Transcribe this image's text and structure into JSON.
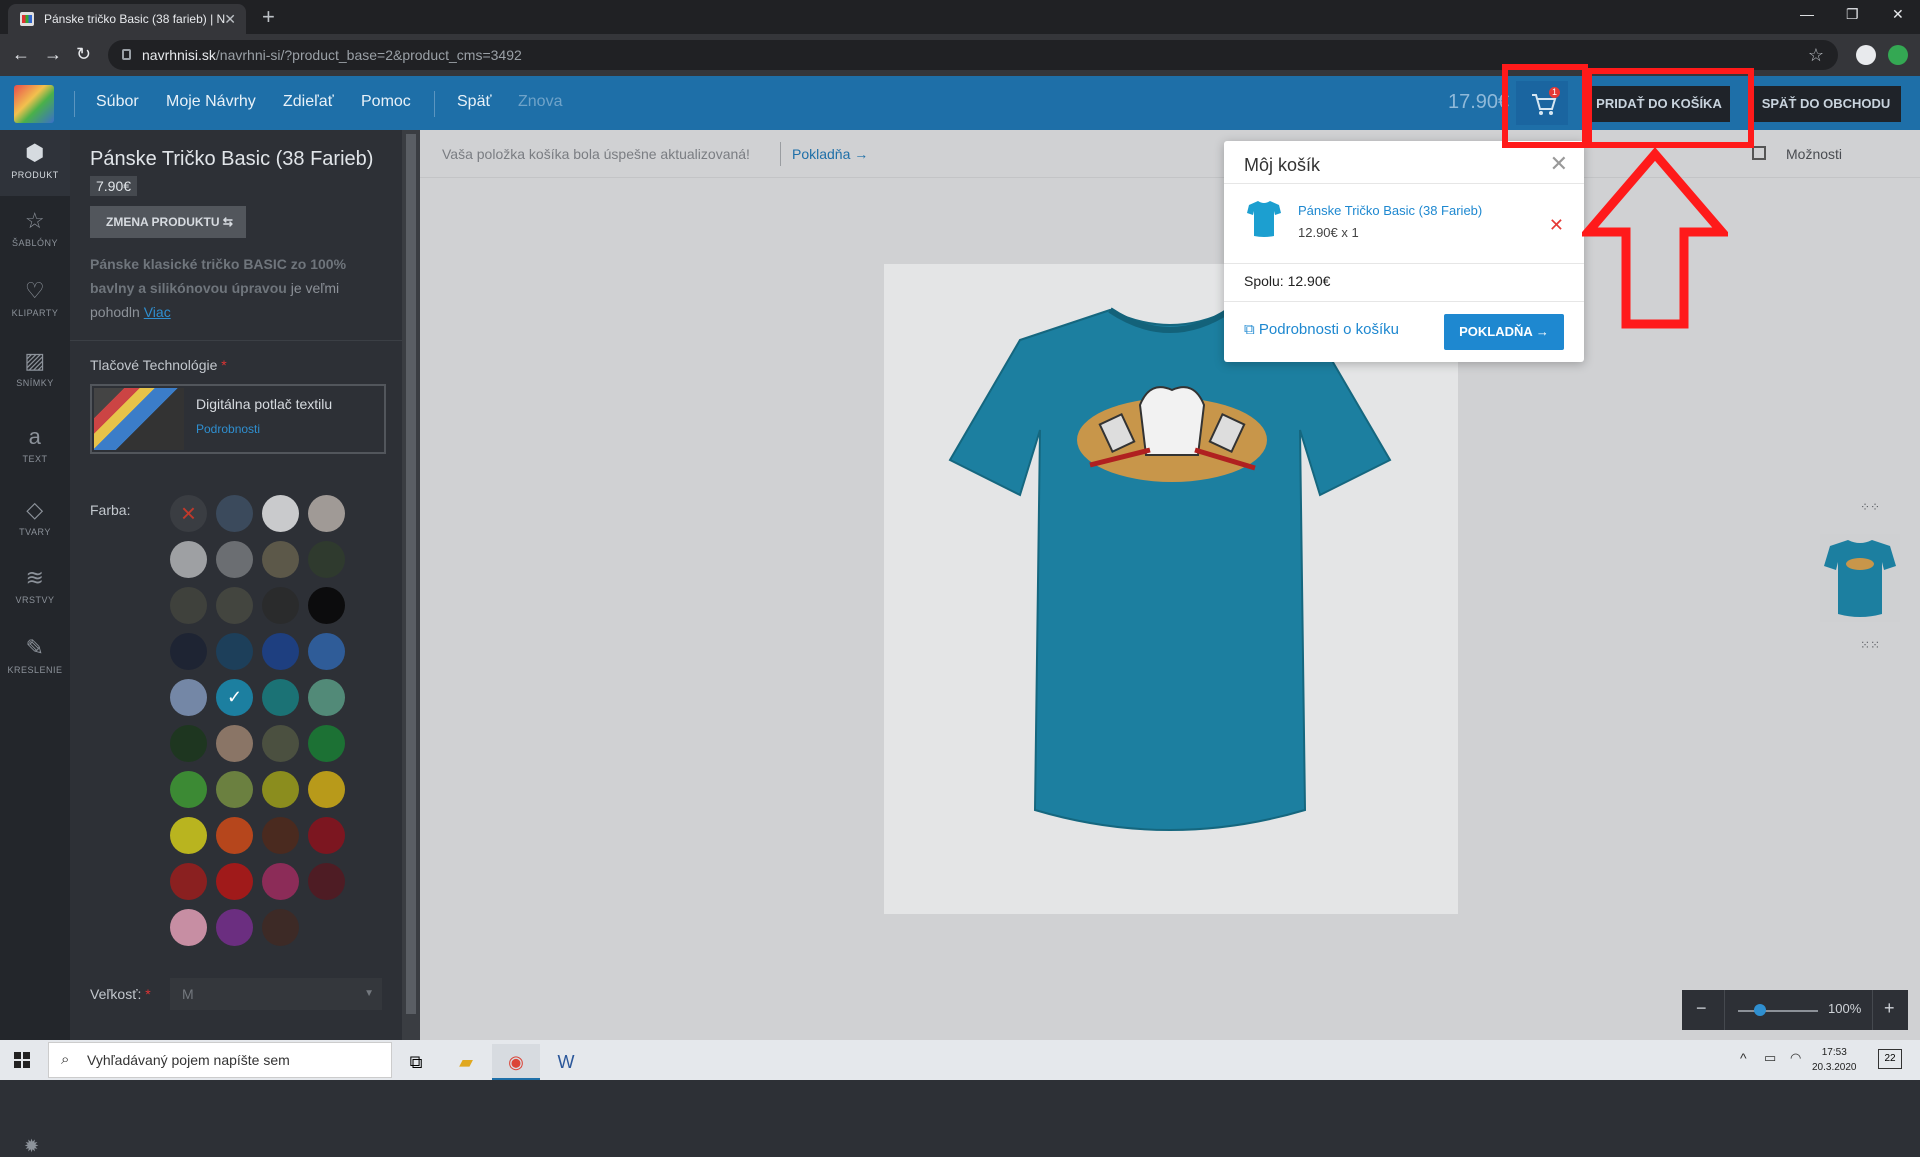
{
  "browser": {
    "tab_title": "Pánske tričko Basic (38 farieb) | N",
    "url_domain": "navrhnisi.sk",
    "url_path": "/navrhni-si/?product_base=2&product_cms=3492"
  },
  "header": {
    "menu": [
      "Súbor",
      "Moje Návrhy",
      "Zdieľať",
      "Pomoc",
      "Späť",
      "Znova"
    ],
    "price": "17.90€",
    "cart_count": "1",
    "add_to_cart_label": "PRIDAŤ DO KOŠÍKA",
    "back_to_shop_label": "SPÄŤ DO OBCHODU"
  },
  "rail": [
    "PRODUKT",
    "ŠABLÓNY",
    "KLIPARTY",
    "SNÍMKY",
    "TEXT",
    "TVARY",
    "VRSTVY",
    "KRESLENIE"
  ],
  "product": {
    "title": "Pánske Tričko Basic (38 Farieb)",
    "price": "7.90€",
    "change_label": "ZMENA PRODUKTU ⇆",
    "desc_bold": "Pánske klasické tričko BASIC zo 100% bavlny a silikónovou úpravou",
    "desc_rest": " je veľmi pohodln ",
    "more_link": "Viac",
    "tech_label": "Tlačové Technológie",
    "tech_name": "Digitálna potlač textilu",
    "tech_link": "Podrobnosti",
    "color_label": "Farba:",
    "size_label": "Veľkosť:",
    "size_value": "M"
  },
  "colors": [
    "#3a3d42",
    "#3b4a5c",
    "#c9cacc",
    "#a09a96",
    "#9ea0a3",
    "#6b6e72",
    "#5c5849",
    "#2f3a2e",
    "#3f413c",
    "#43453f",
    "#2a2b2c",
    "#0c0c0d",
    "#1e2433",
    "#1d3f5a",
    "#1e3f80",
    "#2f5c98",
    "#7487a6",
    "#1c7fa0",
    "#1b7275",
    "#528a78",
    "#1e3620",
    "#8a7566",
    "#4b5040",
    "#1c7134",
    "#3c8a34",
    "#6b8040",
    "#8b8d1e",
    "#b89a1a",
    "#b9b41f",
    "#b6461c",
    "#4a2a1f",
    "#7c1620",
    "#8a2020",
    "#a01a1a",
    "#8c2c58",
    "#4e1c24",
    "#c78ea3",
    "#6b2e80",
    "#3d2a26"
  ],
  "canvas": {
    "notice": "Vaša položka košíka bola úspešne aktualizovaná!",
    "checkout_link": "Pokladňa",
    "options_label": "Možnosti",
    "zoom": "100%"
  },
  "cart_popup": {
    "title": "Môj košík",
    "item_name": "Pánske Tričko Basic (38 Farieb)",
    "item_qty": "12.90€ x 1",
    "total": "Spolu: 12.90€",
    "details_link": "Podrobnosti o košíku",
    "checkout_button": "POKLADŇA"
  },
  "taskbar": {
    "search_placeholder": "Vyhľadávaný pojem napíšte sem",
    "time": "17:53",
    "date": "20.3.2020",
    "notifications": "22"
  },
  "accent_colors": {
    "header": "#1e6fa8",
    "shirt": "#1c7fa0",
    "annotation": "#ff1a1a"
  }
}
